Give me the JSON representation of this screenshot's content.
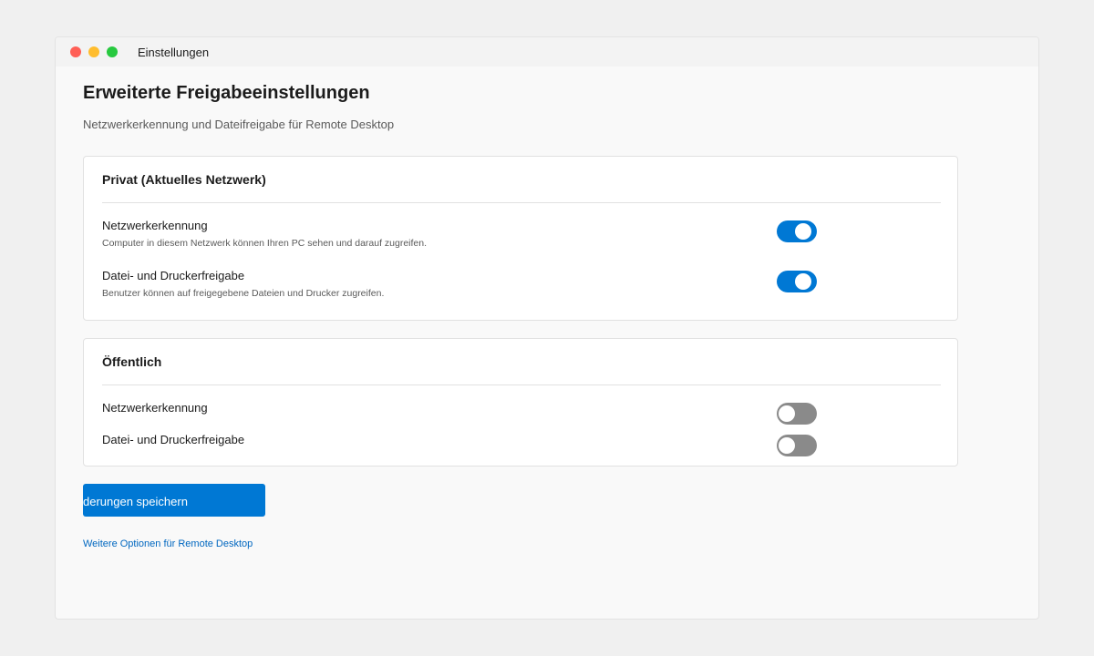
{
  "window": {
    "title": "Einstellungen",
    "controls": [
      "close",
      "minimize",
      "maximize"
    ]
  },
  "page": {
    "title": "Erweiterte Freigabeeinstellungen",
    "subtitle": "Netzwerkerkennung und Dateifreigabe für Remote Desktop"
  },
  "sections": [
    {
      "title": "Privat (Aktuelles Netzwerk)",
      "settings": [
        {
          "label": "Netzwerkerkennung",
          "description": "Computer in diesem Netzwerk können Ihren PC sehen und darauf zugreifen.",
          "enabled": true
        },
        {
          "label": "Datei- und Druckerfreigabe",
          "description": "Benutzer können auf freigegebene Dateien und Drucker zugreifen.",
          "enabled": true
        }
      ]
    },
    {
      "title": "Öffentlich",
      "settings": [
        {
          "label": "Netzwerkerkennung",
          "enabled": false
        },
        {
          "label": "Datei- und Druckerfreigabe",
          "enabled": false
        }
      ]
    }
  ],
  "actions": {
    "save_label": "derungen speichern",
    "more_link": "Weitere Optionen für Remote Desktop"
  },
  "colors": {
    "accent": "#0078d4",
    "toggle_off": "#8a8a8a",
    "link": "#0067c0"
  }
}
